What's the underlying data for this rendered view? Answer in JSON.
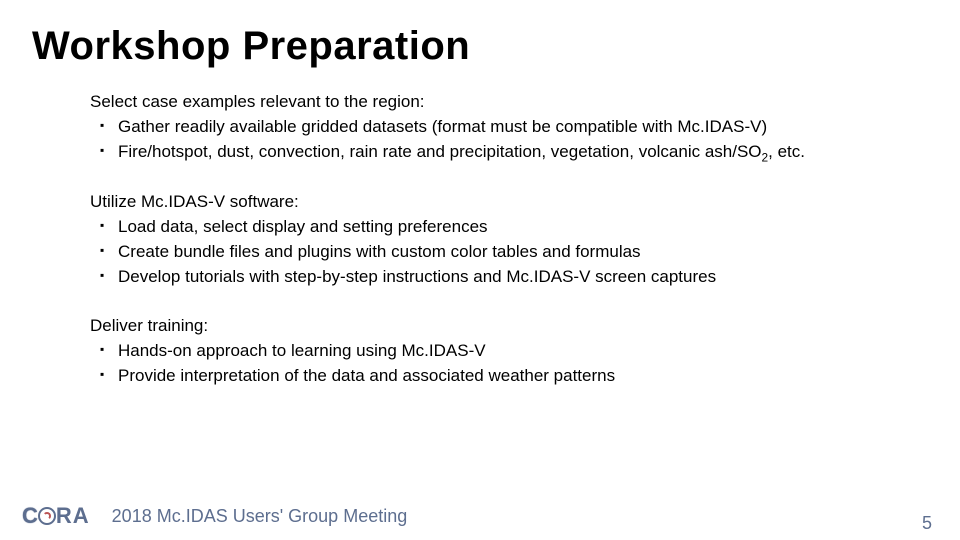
{
  "title": "Workshop Preparation",
  "sections": [
    {
      "lead": "Select case examples relevant to the region:",
      "items": [
        "Gather readily available gridded datasets (format must be compatible with Mc.IDAS-V)",
        "Fire/hotspot, dust, convection, rain rate and precipitation, vegetation, volcanic ash/SO<sub>2</sub>, etc."
      ]
    },
    {
      "lead": "Utilize Mc.IDAS-V software:",
      "items": [
        "Load data, select display and setting preferences",
        "Create bundle files and plugins with custom color tables and formulas",
        "Develop tutorials with step-by-step instructions and Mc.IDAS-V screen captures"
      ]
    },
    {
      "lead": "Deliver training:",
      "items": [
        "Hands-on approach to learning using Mc.IDAS-V",
        "Provide interpretation of the data and associated weather patterns"
      ]
    }
  ],
  "footer": {
    "text": "2018 Mc.IDAS Users' Group Meeting",
    "page": "5",
    "logo_text_1": "C",
    "logo_text_2": "RA"
  },
  "colors": {
    "footer_text": "#5d6e8f",
    "body_text": "#000000"
  }
}
